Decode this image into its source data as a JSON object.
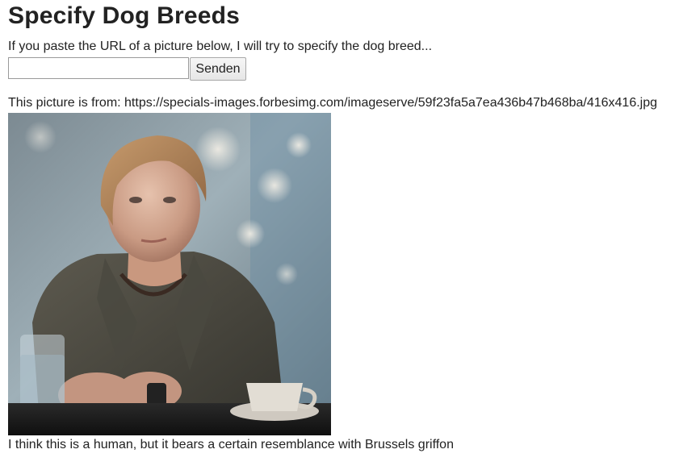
{
  "page": {
    "title": "Specify Dog Breeds",
    "intro": "If you paste the URL of a picture below, I will try to specify the dog breed..."
  },
  "form": {
    "url_value": "",
    "url_placeholder": "",
    "submit_label": "Senden"
  },
  "result": {
    "source_text": "This picture is from: https://specials-images.forbesimg.com/imageserve/59f23fa5a7ea436b47b468ba/416x416.jpg",
    "prediction_text": "I think this is a human, but it bears a certain resemblance with Brussels griffon"
  },
  "colors": {
    "text": "#222222",
    "background": "#ffffff"
  }
}
